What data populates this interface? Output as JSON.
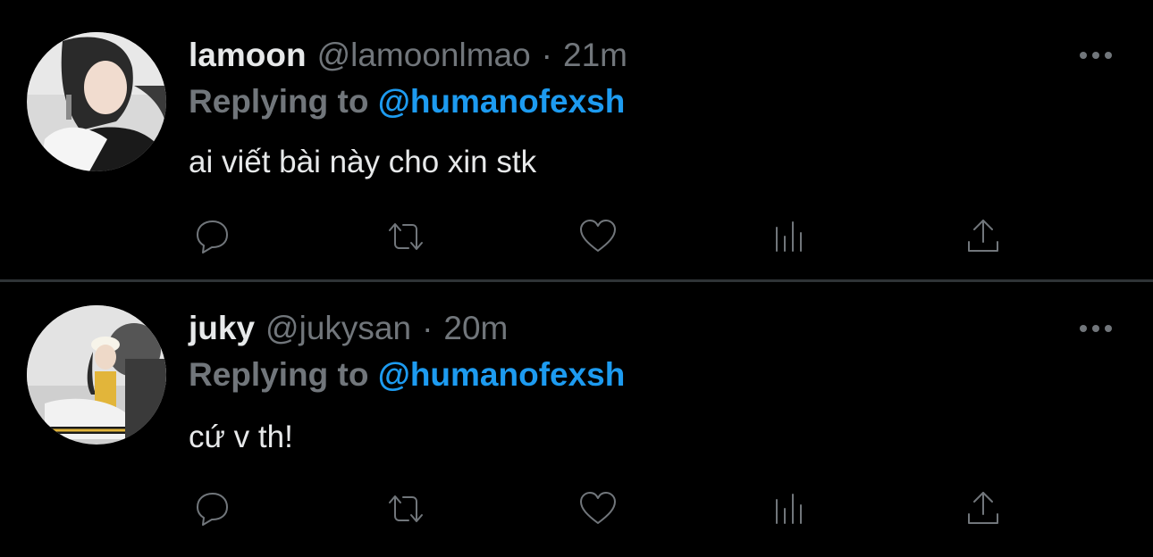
{
  "tweets": [
    {
      "name": "lamoon",
      "handle": "@lamoonlmao",
      "separator": "·",
      "time": "21m",
      "replying_prefix": "Replying to",
      "replying_handle": "@humanofexsh",
      "text": "ai viết bài này cho xin stk"
    },
    {
      "name": "juky",
      "handle": "@jukysan",
      "separator": "·",
      "time": "20m",
      "replying_prefix": "Replying to",
      "replying_handle": "@humanofexsh",
      "text": "cứ v th!"
    }
  ],
  "icons": {
    "reply": "reply-icon",
    "retweet": "retweet-icon",
    "like": "heart-icon",
    "views": "analytics-icon",
    "share": "share-icon",
    "more": "more-dots-icon"
  },
  "colors": {
    "background": "#000000",
    "primary_text": "#e7e9ea",
    "secondary_text": "#71767b",
    "link": "#1d9bf0",
    "divider": "#2f3336"
  }
}
